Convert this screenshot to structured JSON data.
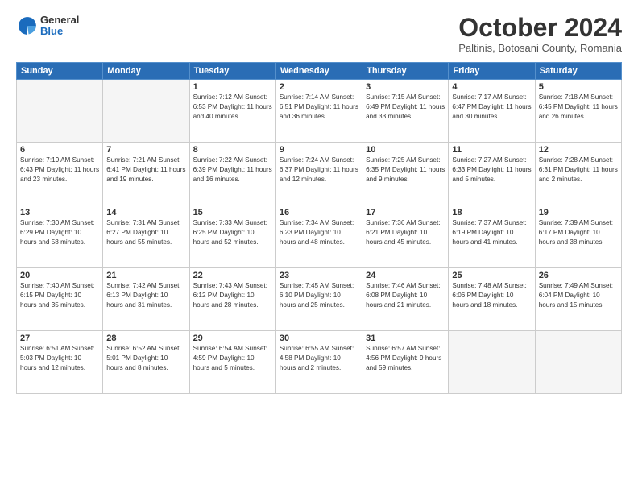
{
  "header": {
    "logo_general": "General",
    "logo_blue": "Blue",
    "month_title": "October 2024",
    "subtitle": "Paltinis, Botosani County, Romania"
  },
  "weekdays": [
    "Sunday",
    "Monday",
    "Tuesday",
    "Wednesday",
    "Thursday",
    "Friday",
    "Saturday"
  ],
  "weeks": [
    [
      {
        "day": "",
        "info": ""
      },
      {
        "day": "",
        "info": ""
      },
      {
        "day": "1",
        "info": "Sunrise: 7:12 AM\nSunset: 6:53 PM\nDaylight: 11 hours\nand 40 minutes."
      },
      {
        "day": "2",
        "info": "Sunrise: 7:14 AM\nSunset: 6:51 PM\nDaylight: 11 hours\nand 36 minutes."
      },
      {
        "day": "3",
        "info": "Sunrise: 7:15 AM\nSunset: 6:49 PM\nDaylight: 11 hours\nand 33 minutes."
      },
      {
        "day": "4",
        "info": "Sunrise: 7:17 AM\nSunset: 6:47 PM\nDaylight: 11 hours\nand 30 minutes."
      },
      {
        "day": "5",
        "info": "Sunrise: 7:18 AM\nSunset: 6:45 PM\nDaylight: 11 hours\nand 26 minutes."
      }
    ],
    [
      {
        "day": "6",
        "info": "Sunrise: 7:19 AM\nSunset: 6:43 PM\nDaylight: 11 hours\nand 23 minutes."
      },
      {
        "day": "7",
        "info": "Sunrise: 7:21 AM\nSunset: 6:41 PM\nDaylight: 11 hours\nand 19 minutes."
      },
      {
        "day": "8",
        "info": "Sunrise: 7:22 AM\nSunset: 6:39 PM\nDaylight: 11 hours\nand 16 minutes."
      },
      {
        "day": "9",
        "info": "Sunrise: 7:24 AM\nSunset: 6:37 PM\nDaylight: 11 hours\nand 12 minutes."
      },
      {
        "day": "10",
        "info": "Sunrise: 7:25 AM\nSunset: 6:35 PM\nDaylight: 11 hours\nand 9 minutes."
      },
      {
        "day": "11",
        "info": "Sunrise: 7:27 AM\nSunset: 6:33 PM\nDaylight: 11 hours\nand 5 minutes."
      },
      {
        "day": "12",
        "info": "Sunrise: 7:28 AM\nSunset: 6:31 PM\nDaylight: 11 hours\nand 2 minutes."
      }
    ],
    [
      {
        "day": "13",
        "info": "Sunrise: 7:30 AM\nSunset: 6:29 PM\nDaylight: 10 hours\nand 58 minutes."
      },
      {
        "day": "14",
        "info": "Sunrise: 7:31 AM\nSunset: 6:27 PM\nDaylight: 10 hours\nand 55 minutes."
      },
      {
        "day": "15",
        "info": "Sunrise: 7:33 AM\nSunset: 6:25 PM\nDaylight: 10 hours\nand 52 minutes."
      },
      {
        "day": "16",
        "info": "Sunrise: 7:34 AM\nSunset: 6:23 PM\nDaylight: 10 hours\nand 48 minutes."
      },
      {
        "day": "17",
        "info": "Sunrise: 7:36 AM\nSunset: 6:21 PM\nDaylight: 10 hours\nand 45 minutes."
      },
      {
        "day": "18",
        "info": "Sunrise: 7:37 AM\nSunset: 6:19 PM\nDaylight: 10 hours\nand 41 minutes."
      },
      {
        "day": "19",
        "info": "Sunrise: 7:39 AM\nSunset: 6:17 PM\nDaylight: 10 hours\nand 38 minutes."
      }
    ],
    [
      {
        "day": "20",
        "info": "Sunrise: 7:40 AM\nSunset: 6:15 PM\nDaylight: 10 hours\nand 35 minutes."
      },
      {
        "day": "21",
        "info": "Sunrise: 7:42 AM\nSunset: 6:13 PM\nDaylight: 10 hours\nand 31 minutes."
      },
      {
        "day": "22",
        "info": "Sunrise: 7:43 AM\nSunset: 6:12 PM\nDaylight: 10 hours\nand 28 minutes."
      },
      {
        "day": "23",
        "info": "Sunrise: 7:45 AM\nSunset: 6:10 PM\nDaylight: 10 hours\nand 25 minutes."
      },
      {
        "day": "24",
        "info": "Sunrise: 7:46 AM\nSunset: 6:08 PM\nDaylight: 10 hours\nand 21 minutes."
      },
      {
        "day": "25",
        "info": "Sunrise: 7:48 AM\nSunset: 6:06 PM\nDaylight: 10 hours\nand 18 minutes."
      },
      {
        "day": "26",
        "info": "Sunrise: 7:49 AM\nSunset: 6:04 PM\nDaylight: 10 hours\nand 15 minutes."
      }
    ],
    [
      {
        "day": "27",
        "info": "Sunrise: 6:51 AM\nSunset: 5:03 PM\nDaylight: 10 hours\nand 12 minutes."
      },
      {
        "day": "28",
        "info": "Sunrise: 6:52 AM\nSunset: 5:01 PM\nDaylight: 10 hours\nand 8 minutes."
      },
      {
        "day": "29",
        "info": "Sunrise: 6:54 AM\nSunset: 4:59 PM\nDaylight: 10 hours\nand 5 minutes."
      },
      {
        "day": "30",
        "info": "Sunrise: 6:55 AM\nSunset: 4:58 PM\nDaylight: 10 hours\nand 2 minutes."
      },
      {
        "day": "31",
        "info": "Sunrise: 6:57 AM\nSunset: 4:56 PM\nDaylight: 9 hours\nand 59 minutes."
      },
      {
        "day": "",
        "info": ""
      },
      {
        "day": "",
        "info": ""
      }
    ]
  ]
}
